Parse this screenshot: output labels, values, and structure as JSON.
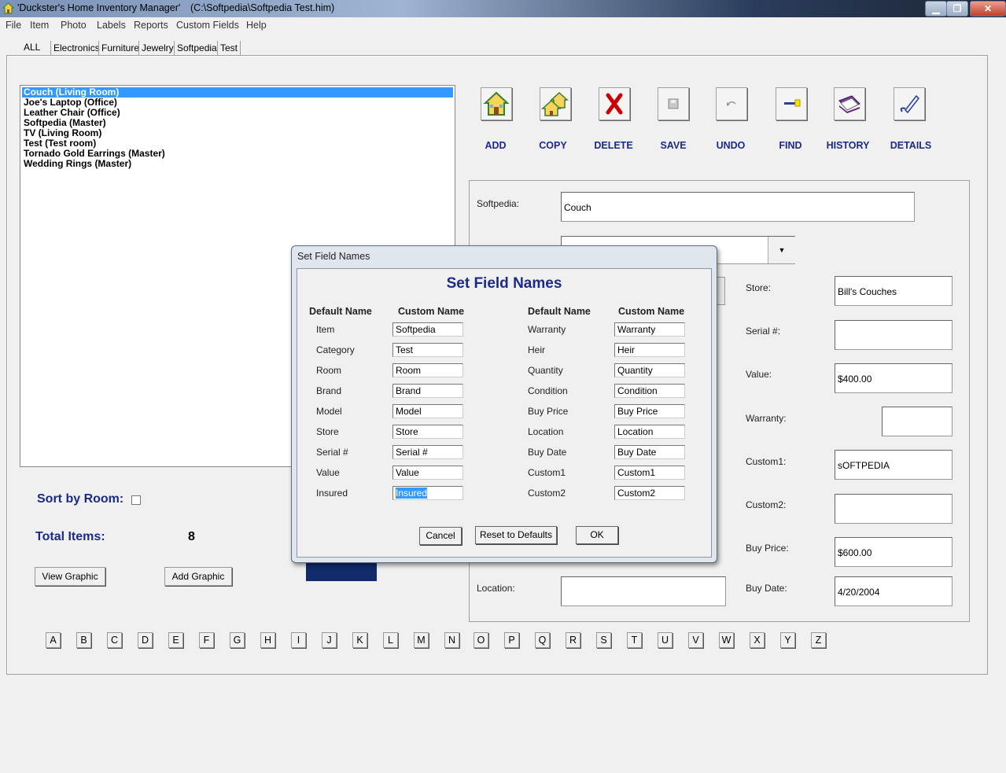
{
  "window": {
    "title": "'Duckster's Home Inventory Manager'",
    "path": "(C:\\Softpedia\\Softpedia Test.him)"
  },
  "menu": [
    "File",
    "Item",
    "Photo",
    "Labels",
    "Reports",
    "Custom Fields",
    "Help"
  ],
  "tabs": [
    "ALL",
    "Electronics",
    "Furniture",
    "Jewelry",
    "Softpedia",
    "Test"
  ],
  "items": [
    "Couch (Living Room)",
    "Joe's Laptop (Office)",
    "Leather Chair (Office)",
    "Softpedia (Master)",
    "TV (Living Room)",
    "Test (Test room)",
    "Tornado Gold Earrings (Master)",
    "Wedding Rings (Master)"
  ],
  "toolbar": [
    "ADD",
    "COPY",
    "DELETE",
    "SAVE",
    "UNDO",
    "FIND",
    "HISTORY",
    "DETAILS"
  ],
  "toolbar_icons": [
    "house-icon",
    "copy-house-icon",
    "red-x-icon",
    "save-icon",
    "undo-icon",
    "find-key-icon",
    "history-book-icon",
    "details-pen-icon"
  ],
  "sort_by_room_label": "Sort by Room:",
  "total_items_label": "Total Items:",
  "total_items_value": "8",
  "view_graphic": "View Graphic",
  "add_graphic": "Add Graphic",
  "letters": [
    "A",
    "B",
    "C",
    "D",
    "E",
    "F",
    "G",
    "H",
    "I",
    "J",
    "K",
    "L",
    "M",
    "N",
    "O",
    "P",
    "Q",
    "R",
    "S",
    "T",
    "U",
    "V",
    "W",
    "X",
    "Y",
    "Z"
  ],
  "fields": {
    "softpedia_label": "Softpedia:",
    "softpedia_value": "Couch",
    "store_label": "Store:",
    "store_value": "Bill's Couches",
    "serial_label": "Serial #:",
    "serial_value": "",
    "value_label": "Value:",
    "value_value": "$400.00",
    "warranty_label": "Warranty:",
    "warranty_value": "",
    "custom1_label": "Custom1:",
    "custom1_value": "sOFTPEDIA",
    "custom2_label": "Custom2:",
    "custom2_value": "",
    "buyprice_label": "Buy Price:",
    "buyprice_value": "$600.00",
    "location_label": "Location:",
    "location_value": "",
    "buydate_label": "Buy Date:",
    "buydate_value": "4/20/2004"
  },
  "dialog": {
    "title": "Set Field Names",
    "heading": "Set Field Names",
    "col_default": "Default Name",
    "col_custom": "Custom Name",
    "left": [
      {
        "def": "Item",
        "custom": "Softpedia"
      },
      {
        "def": "Category",
        "custom": "Test"
      },
      {
        "def": "Room",
        "custom": "Room"
      },
      {
        "def": "Brand",
        "custom": "Brand"
      },
      {
        "def": "Model",
        "custom": "Model"
      },
      {
        "def": "Store",
        "custom": "Store"
      },
      {
        "def": "Serial #",
        "custom": "Serial #"
      },
      {
        "def": "Value",
        "custom": "Value"
      },
      {
        "def": "Insured",
        "custom": "Insured"
      }
    ],
    "right": [
      {
        "def": "Warranty",
        "custom": "Warranty"
      },
      {
        "def": "Heir",
        "custom": "Heir"
      },
      {
        "def": "Quantity",
        "custom": "Quantity"
      },
      {
        "def": "Condition",
        "custom": "Condition"
      },
      {
        "def": "Buy Price",
        "custom": "Buy Price"
      },
      {
        "def": "Location",
        "custom": "Location"
      },
      {
        "def": "Buy Date",
        "custom": "Buy Date"
      },
      {
        "def": "Custom1",
        "custom": "Custom1"
      },
      {
        "def": "Custom2",
        "custom": "Custom2"
      }
    ],
    "cancel": "Cancel",
    "reset": "Reset to Defaults",
    "ok": "OK"
  },
  "colors": {
    "accent": "#1a2a8c",
    "selection": "#3399ff"
  }
}
